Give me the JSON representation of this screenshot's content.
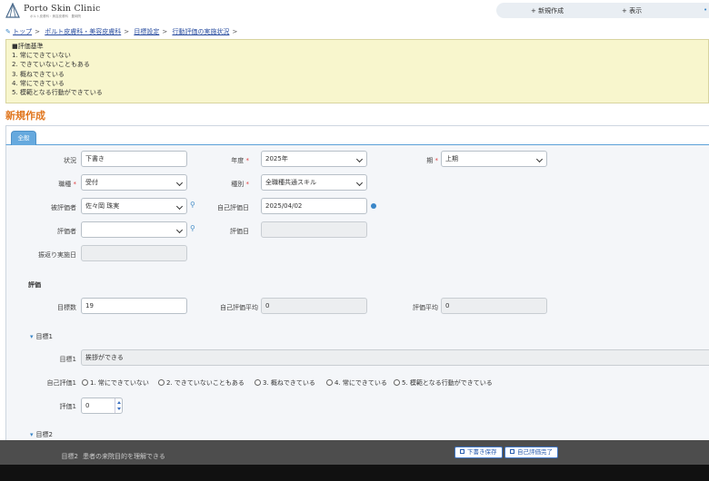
{
  "header": {
    "logo_name": "Porto Skin Clinic",
    "logo_sub": "ポルト皮膚科・美容皮膚科　豊岡院",
    "nav": [
      "+ 新規作成",
      "+ 表示"
    ]
  },
  "breadcrumb": {
    "items": [
      "トップ",
      "ポルト皮膚科・美容皮膚科",
      "目標設定",
      "行動評価の実施状況"
    ]
  },
  "criteria": {
    "title": "■評価基準",
    "items": [
      "1. 常にできていない",
      "2. できていないこともある",
      "3. 概ねできている",
      "4. 常にできている",
      "5. 模範となる行動ができている"
    ]
  },
  "page_title": "新規作成",
  "tab": "全般",
  "form": {
    "status_label": "状況",
    "status_value": "下書き",
    "year_label": "年度",
    "year_value": "2025年",
    "period_label": "期",
    "period_value": "上期",
    "job_label": "職種",
    "job_value": "受付",
    "type_label": "種別",
    "type_value": "全職種共通スキル",
    "evaluatee_label": "被評価者",
    "evaluatee_value": "佐々岡 珠実",
    "self_date_label": "自己評価日",
    "self_date_value": "2025/04/02",
    "evaluator_label": "評価者",
    "evaluator_value": "",
    "eval_date_label": "評価日",
    "eval_date_value": "",
    "review_date_label": "振返り実施日",
    "review_date_value": ""
  },
  "evaluation": {
    "section": "評価",
    "goal_count_label": "目標数",
    "goal_count_value": "19",
    "self_avg_label": "自己評価平均",
    "self_avg_value": "0",
    "eval_avg_label": "評価平均",
    "eval_avg_value": "0"
  },
  "goal1": {
    "header": "目標1",
    "goal_label": "目標1",
    "goal_value": "挨拶ができる",
    "self_label": "自己評価1",
    "options": [
      "1. 常にできていない",
      "2. できていないこともある",
      "3. 概ねできている",
      "4. 常にできている",
      "5. 模範となる行動ができている"
    ],
    "score_label": "評価1",
    "score_value": "0"
  },
  "goal2": {
    "header": "目標2",
    "goal_label": "目標2",
    "goal_value": "患者の来院目的を理解できる"
  },
  "footer": {
    "save_draft": "下書き保存",
    "self_done": "自己評価完了"
  },
  "colors": {
    "accent": "#e0751c",
    "link": "#2a4ea0",
    "criteria_bg": "#f8f6cd",
    "footer_bg": "#4d4d4d"
  }
}
